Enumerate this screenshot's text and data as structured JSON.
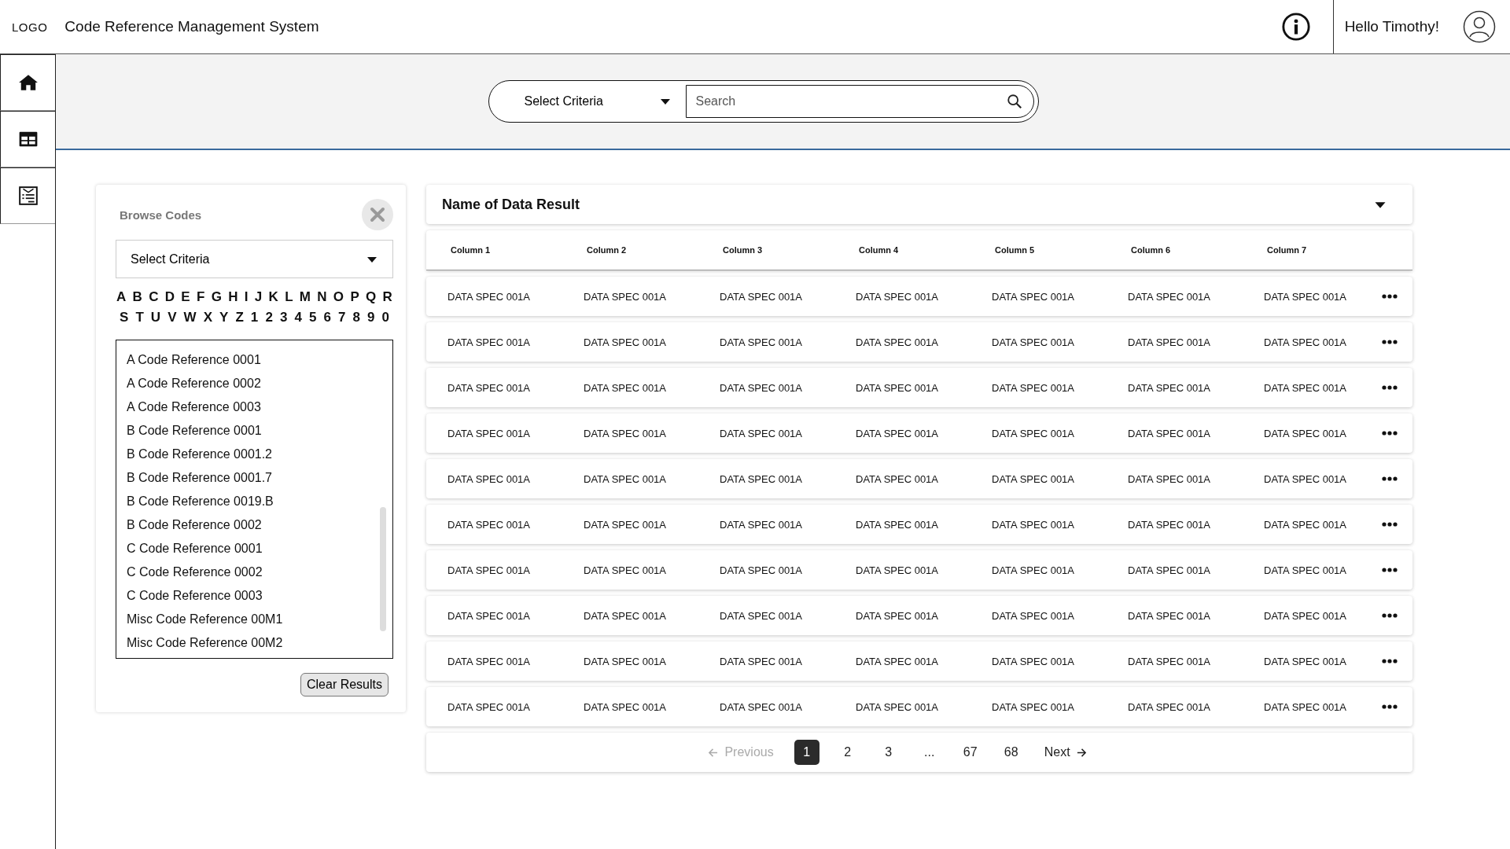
{
  "header": {
    "logo": "LOGO",
    "title": "Code Reference Management System",
    "greeting": "Hello Timothy!"
  },
  "sidebar": {
    "items": [
      {
        "kind": "home",
        "selected": false
      },
      {
        "kind": "table",
        "selected": false
      },
      {
        "kind": "list",
        "selected": false
      }
    ]
  },
  "search_bar": {
    "criteria": "Select Criteria",
    "placeholder": "Search"
  },
  "browse_panel": {
    "title": "Browse Codes",
    "criteria": "Select Criteria",
    "letters": [
      [
        "A",
        "B",
        "C",
        "D",
        "E",
        "F",
        "G",
        "H",
        "I",
        "J",
        "K",
        "L",
        "M",
        "N",
        "O",
        "P",
        "Q",
        "R"
      ],
      [
        "S",
        "T",
        "U",
        "V",
        "W",
        "X",
        "Y",
        "Z",
        "1",
        "2",
        "3",
        "4",
        "5",
        "6",
        "7",
        "8",
        "9",
        "0"
      ]
    ],
    "codes": [
      "A Code Reference 0001",
      "A Code Reference 0002",
      "A Code Reference 0003",
      "B Code Reference 0001",
      "B Code Reference 0001.2",
      "B Code Reference 0001.7",
      "B Code Reference 0019.B",
      "B Code Reference 0002",
      "C Code Reference 0001",
      "C Code Reference 0002",
      "C Code Reference 0003",
      "Misc Code Reference 00M1",
      "Misc Code Reference 00M2"
    ],
    "clear_button": "Clear Results"
  },
  "results": {
    "title": "Name of Data Result",
    "table": {
      "columns": [
        "Column 1",
        "Column 2",
        "Column 3",
        "Column 4",
        "Column 5",
        "Column 6",
        "Column 7"
      ],
      "rows": [
        [
          "DATA SPEC 001A",
          "DATA SPEC 001A",
          "DATA SPEC 001A",
          "DATA SPEC 001A",
          "DATA SPEC 001A",
          "DATA SPEC 001A",
          "DATA SPEC 001A"
        ],
        [
          "DATA SPEC 001A",
          "DATA SPEC 001A",
          "DATA SPEC 001A",
          "DATA SPEC 001A",
          "DATA SPEC 001A",
          "DATA SPEC 001A",
          "DATA SPEC 001A"
        ],
        [
          "DATA SPEC 001A",
          "DATA SPEC 001A",
          "DATA SPEC 001A",
          "DATA SPEC 001A",
          "DATA SPEC 001A",
          "DATA SPEC 001A",
          "DATA SPEC 001A"
        ],
        [
          "DATA SPEC 001A",
          "DATA SPEC 001A",
          "DATA SPEC 001A",
          "DATA SPEC 001A",
          "DATA SPEC 001A",
          "DATA SPEC 001A",
          "DATA SPEC 001A"
        ],
        [
          "DATA SPEC 001A",
          "DATA SPEC 001A",
          "DATA SPEC 001A",
          "DATA SPEC 001A",
          "DATA SPEC 001A",
          "DATA SPEC 001A",
          "DATA SPEC 001A"
        ],
        [
          "DATA SPEC 001A",
          "DATA SPEC 001A",
          "DATA SPEC 001A",
          "DATA SPEC 001A",
          "DATA SPEC 001A",
          "DATA SPEC 001A",
          "DATA SPEC 001A"
        ],
        [
          "DATA SPEC 001A",
          "DATA SPEC 001A",
          "DATA SPEC 001A",
          "DATA SPEC 001A",
          "DATA SPEC 001A",
          "DATA SPEC 001A",
          "DATA SPEC 001A"
        ],
        [
          "DATA SPEC 001A",
          "DATA SPEC 001A",
          "DATA SPEC 001A",
          "DATA SPEC 001A",
          "DATA SPEC 001A",
          "DATA SPEC 001A",
          "DATA SPEC 001A"
        ],
        [
          "DATA SPEC 001A",
          "DATA SPEC 001A",
          "DATA SPEC 001A",
          "DATA SPEC 001A",
          "DATA SPEC 001A",
          "DATA SPEC 001A",
          "DATA SPEC 001A"
        ],
        [
          "DATA SPEC 001A",
          "DATA SPEC 001A",
          "DATA SPEC 001A",
          "DATA SPEC 001A",
          "DATA SPEC 001A",
          "DATA SPEC 001A",
          "DATA SPEC 001A"
        ]
      ]
    },
    "pagination": {
      "previous": {
        "label": "Previous",
        "disabled": true
      },
      "pages": [
        {
          "label": "1",
          "selected": true
        },
        {
          "label": "2",
          "selected": false
        },
        {
          "label": "3",
          "selected": false
        },
        {
          "label": "...",
          "selected": false
        },
        {
          "label": "67",
          "selected": false
        },
        {
          "label": "68",
          "selected": false
        }
      ],
      "next": {
        "label": "Next",
        "disabled": false
      }
    }
  }
}
